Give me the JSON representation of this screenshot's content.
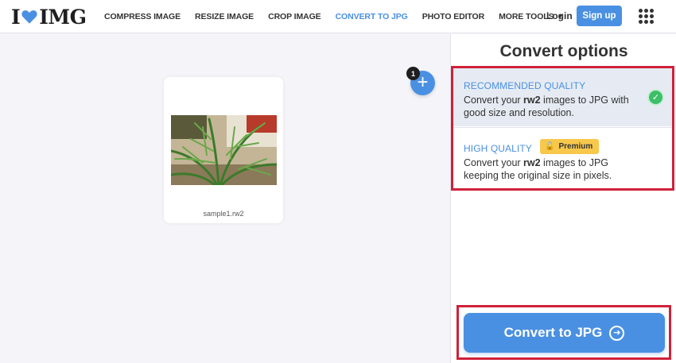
{
  "brand": {
    "pre": "I",
    "post": "IMG",
    "heart_color": "#4a90e2"
  },
  "nav": {
    "items": [
      "COMPRESS IMAGE",
      "RESIZE IMAGE",
      "CROP IMAGE",
      "CONVERT TO JPG",
      "PHOTO EDITOR",
      "MORE TOOLS"
    ],
    "active": "CONVERT TO JPG",
    "login": "Login",
    "signup": "Sign up",
    "apps_icon": "grid-icon"
  },
  "workspace": {
    "file_name": "sample1.rw2",
    "file_count": "1",
    "add_icon": "+"
  },
  "sidebar": {
    "title": "Convert options",
    "options": [
      {
        "title": "RECOMMENDED QUALITY",
        "desc_pre": "Convert your ",
        "desc_bold": "rw2",
        "desc_post": " images to JPG with good size and resolution.",
        "selected": true
      },
      {
        "title": "HIGH QUALITY",
        "badge": "Premium",
        "desc_pre": "Convert your ",
        "desc_bold": "rw2",
        "desc_post": " images to JPG keeping the original size in pixels.",
        "selected": false
      }
    ],
    "button": "Convert to JPG"
  },
  "colors": {
    "accent": "#4a90e2",
    "highlight": "#d0213a",
    "success": "#3cbf68",
    "premium": "#f8c84c"
  }
}
